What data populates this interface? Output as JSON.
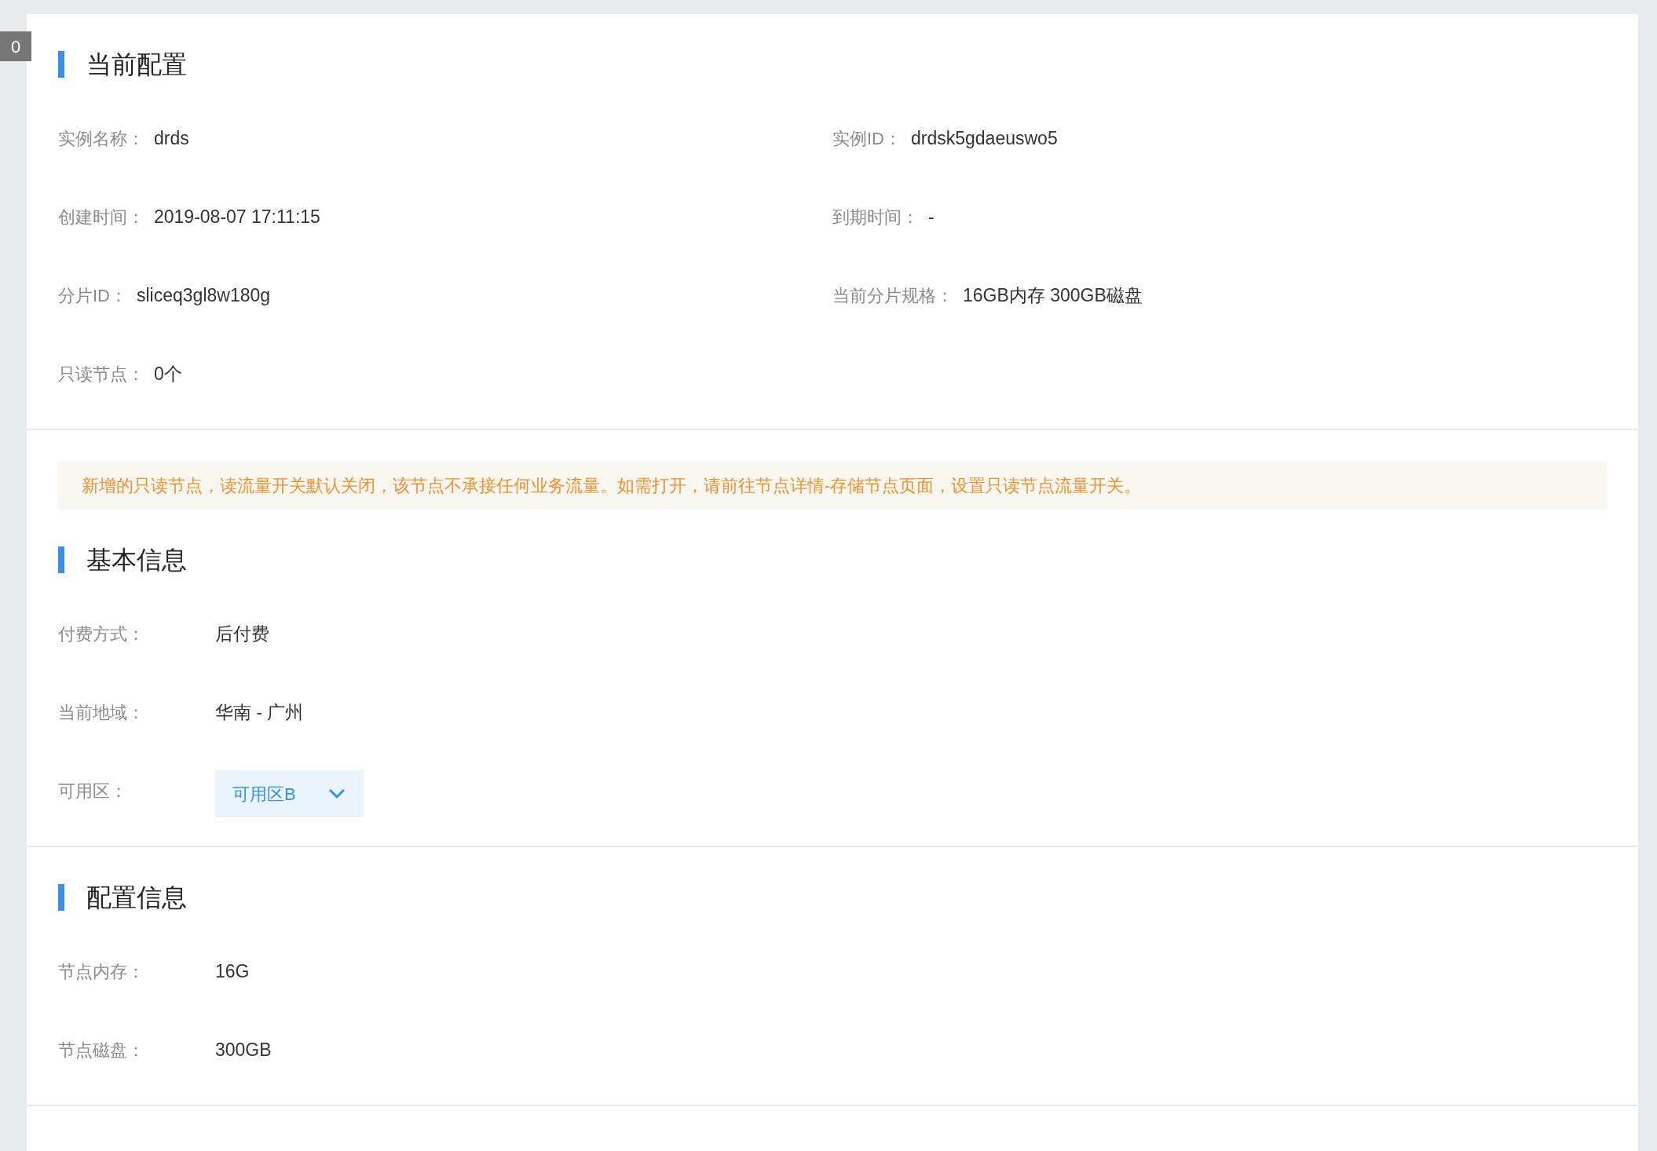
{
  "badge": "0",
  "sections": [
    {
      "title": "当前配置",
      "kind": "grid",
      "rows": [
        {
          "label": "实例名称：",
          "value": "drds"
        },
        {
          "label": "实例ID：",
          "value": "drdsk5gdaeuswo5"
        },
        {
          "label": "创建时间：",
          "value": "2019-08-07 17:11:15"
        },
        {
          "label": "到期时间：",
          "value": "-"
        },
        {
          "label": "分片ID：",
          "value": "sliceq3gl8w180g"
        },
        {
          "label": "当前分片规格：",
          "value": "16GB内存 300GB磁盘"
        },
        {
          "label": "只读节点：",
          "value": "0个"
        }
      ]
    },
    {
      "notice": "新增的只读节点，读流量开关默认关闭，该节点不承接任何业务流量。如需打开，请前往节点详情-存储节点页面，设置只读节点流量开关。",
      "title": "基本信息",
      "kind": "list",
      "rows": [
        {
          "label": "付费方式：",
          "value": "后付费",
          "kind": "text"
        },
        {
          "label": "当前地域：",
          "value": "华南 - 广州",
          "kind": "text"
        },
        {
          "label": "可用区：",
          "value": "可用区B",
          "kind": "select"
        }
      ]
    },
    {
      "title": "配置信息",
      "kind": "list",
      "rows": [
        {
          "label": "节点内存：",
          "value": "16G",
          "kind": "text"
        },
        {
          "label": "节点磁盘：",
          "value": "300GB",
          "kind": "text"
        }
      ]
    }
  ]
}
